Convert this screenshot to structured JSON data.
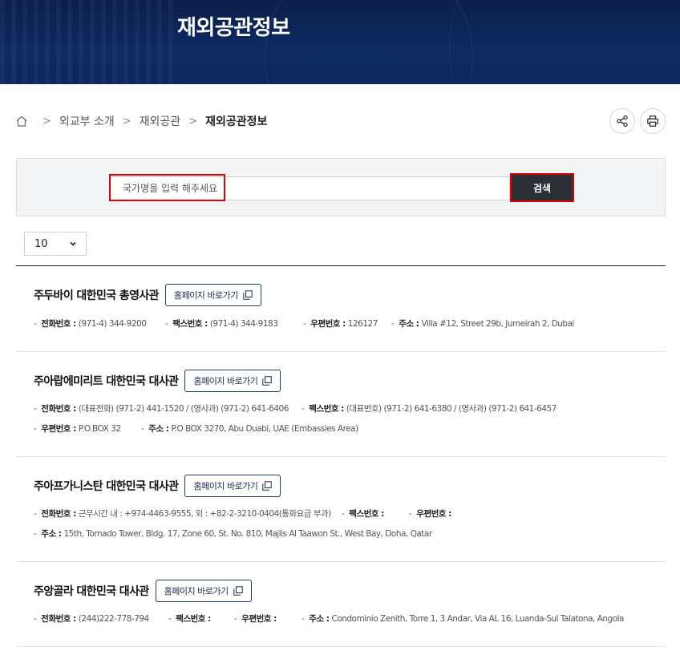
{
  "header": {
    "title": "재외공관정보"
  },
  "breadcrumb": {
    "items": [
      "외교부 소개",
      "재외공관"
    ],
    "current": "재외공관정보"
  },
  "actions": {
    "share_icon": "share-icon",
    "print_icon": "print-icon"
  },
  "search": {
    "placeholder": "국가명을 입력 해주세요",
    "button_label": "검색"
  },
  "page_size": {
    "selected": "10"
  },
  "labels": {
    "homepage": "홈페이지 바로가기",
    "phone": "전화번호 :",
    "fax": "팩스번호 :",
    "zip": "우편번호 :",
    "address": "주소 :"
  },
  "embassies": [
    {
      "name": "주두바이 대한민국 총영사관",
      "phone": "(971-4) 344-9200",
      "fax": "(971-4) 344-9183",
      "zip": "126127",
      "address": "Villa #12, Street 29b, Jumeirah 2, Dubai"
    },
    {
      "name": "주아랍에미리트 대한민국 대사관",
      "phone": "(대표전화) (971-2) 441-1520 / (영사과) (971-2) 641-6406",
      "fax": "(대표번호) (971-2) 641-6380 / (영사과) (971-2) 641-6457",
      "zip": "P.O.BOX 32",
      "address": "P.O BOX 3270, Abu Duabi, UAE (Embassies Area)"
    },
    {
      "name": "주아프가니스탄 대한민국 대사관",
      "phone": "근무시간 내 : +974-4463-9555, 외 : +82-2-3210-0404(통화요금 부과)",
      "fax": "",
      "zip": "",
      "address": "15th, Tornado Tower, Bldg. 17, Zone 60, St. No. 810, Majlis Al Taawon St., West Bay, Doha, Qatar"
    },
    {
      "name": "주앙골라 대한민국 대사관",
      "phone": "(244)222-778-794",
      "fax": "",
      "zip": "",
      "address": "Condominio Zenith, Torre 1, 3 Andar, Via AL 16, Luanda-Sul Talatona, Angola"
    }
  ]
}
